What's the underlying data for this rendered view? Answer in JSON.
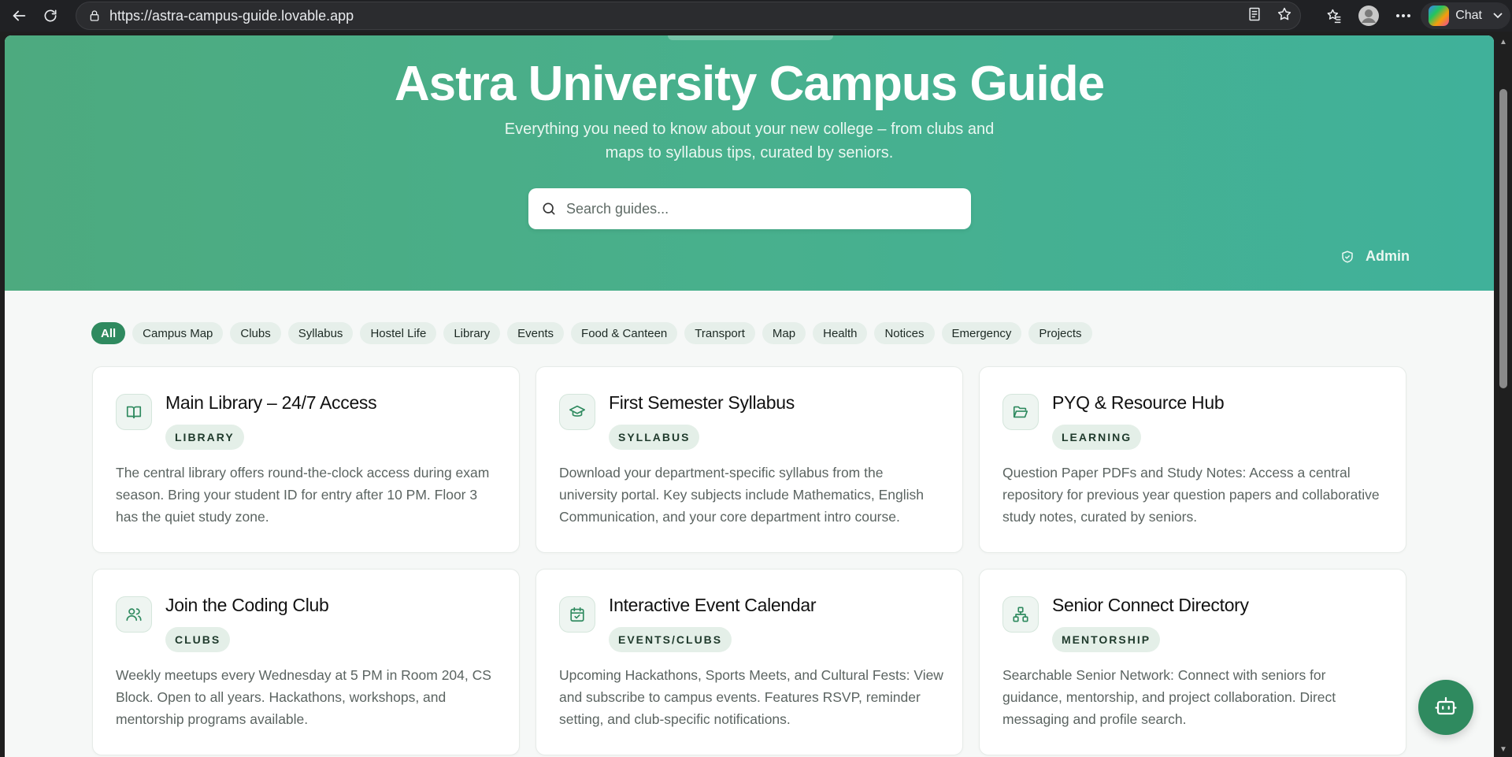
{
  "browser": {
    "url": "https://astra-campus-guide.lovable.app",
    "chat_label": "Chat"
  },
  "hero": {
    "title": "Astra University Campus Guide",
    "subtitle": "Everything you need to know about your new college – from clubs and maps to syllabus tips, curated by seniors.",
    "search_placeholder": "Search guides...",
    "admin_label": "Admin"
  },
  "filters": [
    "All",
    "Campus Map",
    "Clubs",
    "Syllabus",
    "Hostel Life",
    "Library",
    "Events",
    "Food & Canteen",
    "Transport",
    "Map",
    "Health",
    "Notices",
    "Emergency",
    "Projects"
  ],
  "active_filter": "All",
  "cards": [
    {
      "icon": "book-open-icon",
      "title": "Main Library – 24/7 Access",
      "tag": "LIBRARY",
      "desc": "The central library offers round-the-clock access during exam season. Bring your student ID for entry after 10 PM. Floor 3 has the quiet study zone."
    },
    {
      "icon": "graduation-cap-icon",
      "title": "First Semester Syllabus",
      "tag": "SYLLABUS",
      "desc": "Download your department-specific syllabus from the university portal. Key subjects include Mathematics, English Communication, and your core department intro course."
    },
    {
      "icon": "folder-open-icon",
      "title": "PYQ & Resource Hub",
      "tag": "LEARNING",
      "desc": "Question Paper PDFs and Study Notes: Access a central repository for previous year question papers and collaborative study notes, curated by seniors."
    },
    {
      "icon": "users-icon",
      "title": "Join the Coding Club",
      "tag": "CLUBS",
      "desc": "Weekly meetups every Wednesday at 5 PM in Room 204, CS Block. Open to all years. Hackathons, workshops, and mentorship programs available."
    },
    {
      "icon": "calendar-check-icon",
      "title": "Interactive Event Calendar",
      "tag": "EVENTS/CLUBS",
      "desc": "Upcoming Hackathons, Sports Meets, and Cultural Fests: View and subscribe to campus events. Features RSVP, reminder setting, and club-specific notifications."
    },
    {
      "icon": "network-icon",
      "title": "Senior Connect Directory",
      "tag": "MENTORSHIP",
      "desc": "Searchable Senior Network: Connect with seniors for guidance, mentorship, and project collaboration. Direct messaging and profile search."
    }
  ],
  "colors": {
    "brand": "#2f8a5f",
    "hero_start": "#4daa7f",
    "hero_end": "#40b19a",
    "chip_bg": "#e6efea"
  }
}
